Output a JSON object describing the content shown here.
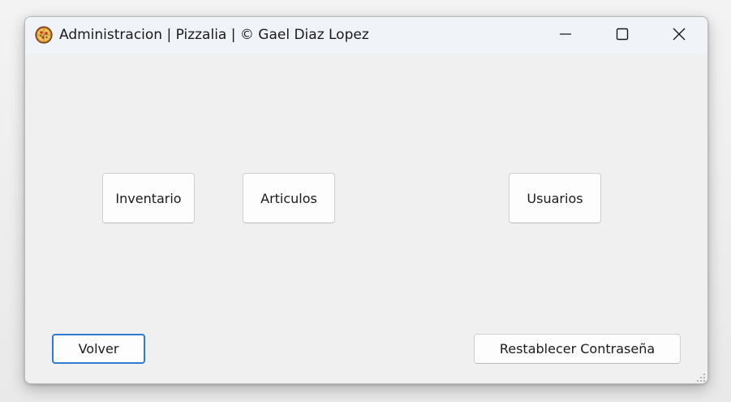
{
  "window": {
    "title": "Administracion | Pizzalia |  © Gael Diaz Lopez",
    "app_icon": "pizza-icon",
    "caption_buttons": [
      "minimize-icon",
      "maximize-icon",
      "close-icon"
    ]
  },
  "main": {
    "inventario_label": "Inventario",
    "articulos_label": "Articulos",
    "usuarios_label": "Usuarios"
  },
  "footer": {
    "volver_label": "Volver",
    "restablecer_label": "Restablecer Contraseña"
  },
  "colors": {
    "focus_border": "#2e7bd1",
    "window_bg": "#f0f0f0",
    "titlebar_bg": "#f0f4f9"
  }
}
